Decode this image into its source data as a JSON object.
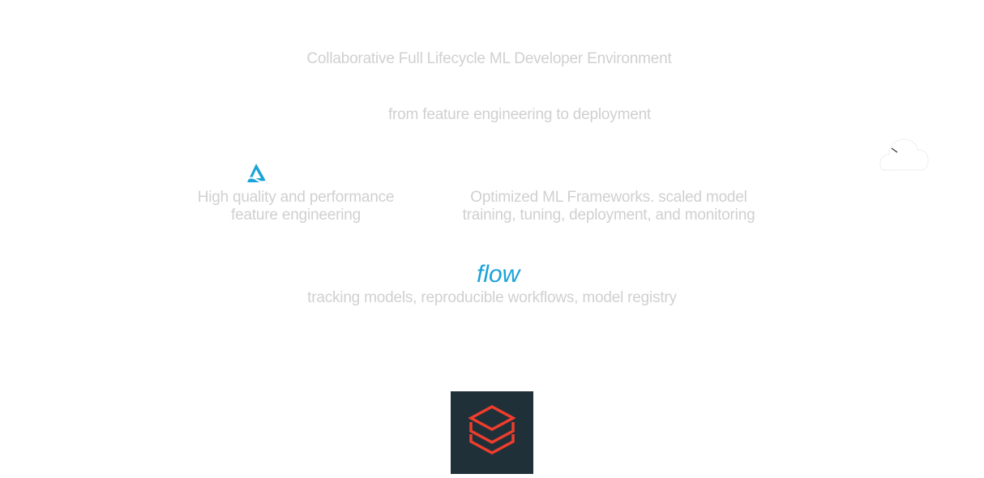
{
  "slide": {
    "title": "Collaborative Full Lifecycle ML Developer Environment",
    "subtitle": "from feature engineering to deployment",
    "features": [
      {
        "icon": "triangle-wave-logo-icon",
        "line1": "High quality and performance",
        "line2": "feature engineering"
      },
      {
        "icon": "cloud-icon",
        "line1": "Optimized ML Frameworks. scaled model",
        "line2": "training, tuning, deployment, and monitoring"
      },
      {
        "icon": "flow-logo-icon",
        "logo_text": "flow",
        "line1": "tracking models, reproducible workflows, model registry"
      }
    ],
    "bottom_logo": "stacked-layers-logo-icon",
    "colors": {
      "text": "#d0d0d0",
      "accent_blue": "#1aa3d9",
      "logo_bg": "#1f3039",
      "logo_red": "#ee3d2c"
    }
  }
}
